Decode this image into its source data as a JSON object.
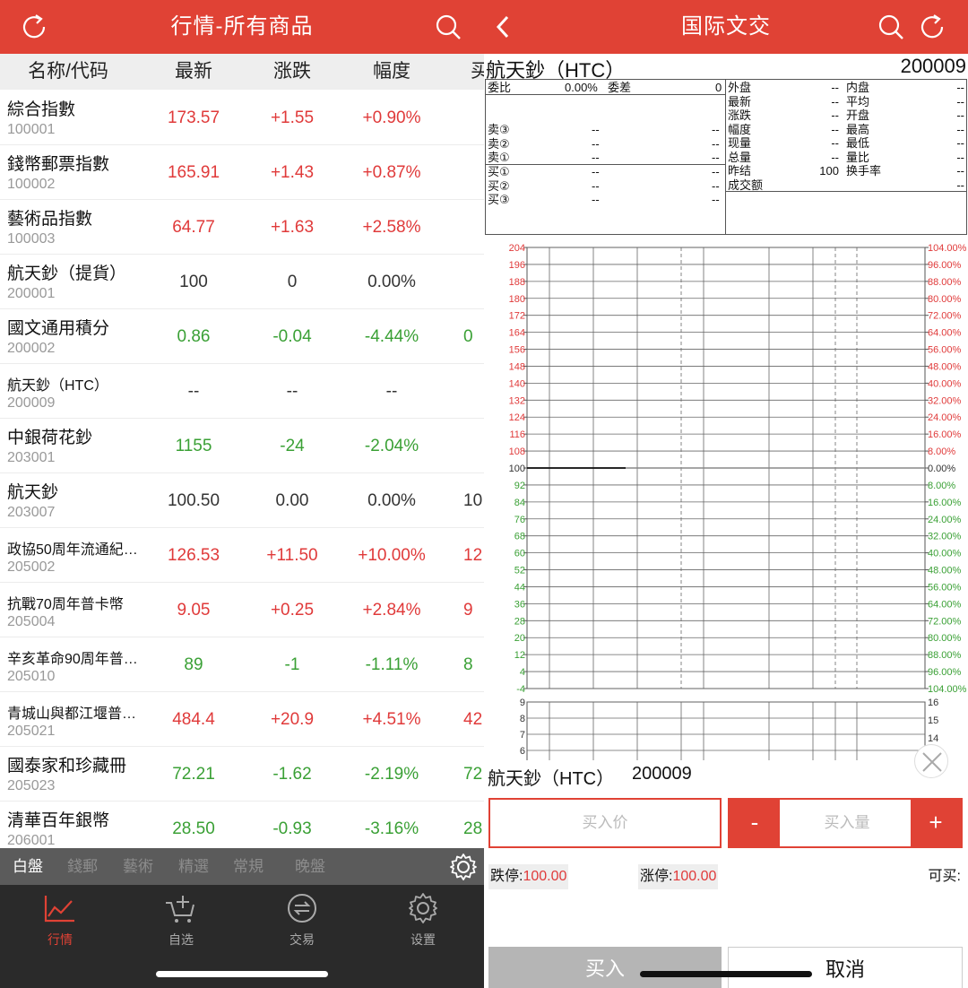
{
  "left": {
    "title": "行情-所有商品",
    "columns": [
      "名称/代码",
      "最新",
      "涨跌",
      "幅度",
      "买"
    ],
    "rows": [
      {
        "name": "綜合指數",
        "code": "100001",
        "latest": "173.57",
        "change": "+1.55",
        "pct": "+0.90%",
        "extra": "",
        "color": "red"
      },
      {
        "name": "錢幣郵票指數",
        "code": "100002",
        "latest": "165.91",
        "change": "+1.43",
        "pct": "+0.87%",
        "extra": "",
        "color": "red"
      },
      {
        "name": "藝術品指數",
        "code": "100003",
        "latest": "64.77",
        "change": "+1.63",
        "pct": "+2.58%",
        "extra": "",
        "color": "red"
      },
      {
        "name": "航天鈔（提貨）",
        "code": "200001",
        "latest": "100",
        "change": "0",
        "pct": "0.00%",
        "extra": "",
        "color": "black"
      },
      {
        "name": "國文通用積分",
        "code": "200002",
        "latest": "0.86",
        "change": "-0.04",
        "pct": "-4.44%",
        "extra": "0",
        "color": "green"
      },
      {
        "name": "航天鈔（HTC）",
        "code": "200009",
        "latest": "--",
        "change": "--",
        "pct": "--",
        "extra": "",
        "color": "black"
      },
      {
        "name": "中銀荷花鈔",
        "code": "203001",
        "latest": "1155",
        "change": "-24",
        "pct": "-2.04%",
        "extra": "",
        "color": "green"
      },
      {
        "name": "航天鈔",
        "code": "203007",
        "latest": "100.50",
        "change": "0.00",
        "pct": "0.00%",
        "extra": "10",
        "color": "black"
      },
      {
        "name": "政協50周年流通紀…",
        "code": "205002",
        "latest": "126.53",
        "change": "+11.50",
        "pct": "+10.00%",
        "extra": "12",
        "color": "red"
      },
      {
        "name": "抗戰70周年普卡幣",
        "code": "205004",
        "latest": "9.05",
        "change": "+0.25",
        "pct": "+2.84%",
        "extra": "9",
        "color": "red"
      },
      {
        "name": "辛亥革命90周年普…",
        "code": "205010",
        "latest": "89",
        "change": "-1",
        "pct": "-1.11%",
        "extra": "8",
        "color": "green"
      },
      {
        "name": "青城山與都江堰普…",
        "code": "205021",
        "latest": "484.4",
        "change": "+20.9",
        "pct": "+4.51%",
        "extra": "42",
        "color": "red"
      },
      {
        "name": "國泰家和珍藏冊",
        "code": "205023",
        "latest": "72.21",
        "change": "-1.62",
        "pct": "-2.19%",
        "extra": "72",
        "color": "green"
      },
      {
        "name": "清華百年銀幣",
        "code": "206001",
        "latest": "28.50",
        "change": "-0.93",
        "pct": "-3.16%",
        "extra": "28",
        "color": "green"
      }
    ],
    "categories": [
      "白盤",
      "錢郵",
      "藝術",
      "精選",
      "常規",
      "晚盤"
    ],
    "nav": [
      "行情",
      "自选",
      "交易",
      "设置"
    ]
  },
  "right": {
    "title": "国际文交",
    "product_name": "航天鈔（HTC）",
    "product_code": "200009",
    "orderbook": {
      "weibi_label": "委比",
      "weibi_value": "0.00%",
      "weicha_label": "委差",
      "weicha_value": "0",
      "sells": [
        "卖③",
        "卖②",
        "卖①"
      ],
      "buys": [
        "买①",
        "买②",
        "买③"
      ],
      "dash": "--"
    },
    "stats": [
      {
        "l1": "外盘",
        "v1": "--",
        "l2": "内盘",
        "v2": "--"
      },
      {
        "l1": "最新",
        "v1": "--",
        "l2": "平均",
        "v2": "--"
      },
      {
        "l1": "涨跌",
        "v1": "--",
        "l2": "开盘",
        "v2": "--"
      },
      {
        "l1": "幅度",
        "v1": "--",
        "l2": "最高",
        "v2": "--"
      },
      {
        "l1": "现量",
        "v1": "--",
        "l2": "最低",
        "v2": "--"
      },
      {
        "l1": "总量",
        "v1": "--",
        "l2": "量比",
        "v2": "--"
      },
      {
        "l1": "昨结",
        "v1": "100",
        "l2": "换手率",
        "v2": "--"
      },
      {
        "l1": "成交额",
        "v1": "",
        "l2": "",
        "v2": "--"
      }
    ],
    "price_ticks": [
      "204",
      "196",
      "188",
      "180",
      "172",
      "164",
      "156",
      "148",
      "140",
      "132",
      "124",
      "116",
      "108",
      "100",
      "92",
      "84",
      "76",
      "68",
      "60",
      "52",
      "44",
      "36",
      "28",
      "20",
      "12",
      "4",
      "-4"
    ],
    "pct_ticks": [
      "104.00%",
      "96.00%",
      "88.00%",
      "80.00%",
      "72.00%",
      "64.00%",
      "56.00%",
      "48.00%",
      "40.00%",
      "32.00%",
      "24.00%",
      "16.00%",
      "8.00%",
      "0.00%",
      "8.00%",
      "16.00%",
      "24.00%",
      "32.00%",
      "40.00%",
      "48.00%",
      "56.00%",
      "64.00%",
      "72.00%",
      "80.00%",
      "88.00%",
      "96.00%",
      "104.00%"
    ],
    "vol_left_ticks": [
      "9",
      "8",
      "7",
      "6"
    ],
    "vol_right_ticks": [
      "16",
      "15",
      "14"
    ],
    "trade": {
      "name": "航天鈔（HTC）",
      "code": "200009",
      "price_placeholder": "买入价",
      "qty_placeholder": "买入量",
      "minus": "-",
      "plus": "+",
      "limit_down_label": "跌停:",
      "limit_down": "100.00",
      "limit_up_label": "涨停:",
      "limit_up": "100.00",
      "can_buy": "可买:",
      "buy": "买入",
      "cancel": "取消"
    },
    "colors": {
      "accent": "#e04235",
      "up": "#e03a3a",
      "down": "#3aa035"
    }
  }
}
